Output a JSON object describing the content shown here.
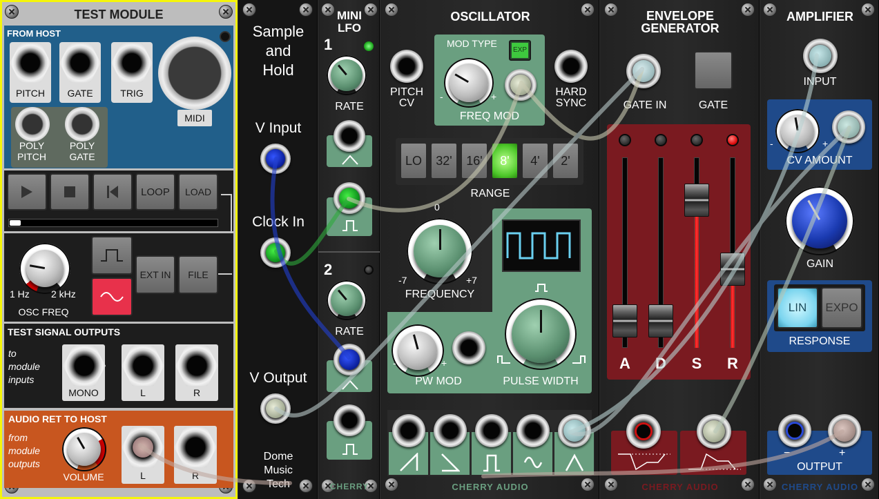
{
  "test_module": {
    "title": "TEST MODULE",
    "from_host": "FROM HOST",
    "pitch": "PITCH",
    "gate": "GATE",
    "trig": "TRIG",
    "midi": "MIDI",
    "poly_pitch": "POLY\nPITCH",
    "poly_gate": "POLY\nGATE",
    "loop": "LOOP",
    "load": "LOAD",
    "ext_in": "EXT IN",
    "file": "FILE",
    "freq_min": "1 Hz",
    "freq_max": "2 kHz",
    "osc_freq": "OSC FREQ",
    "test_outputs": "TEST SIGNAL OUTPUTS",
    "to_module_inputs": "to\nmodule\ninputs",
    "mono": "MONO",
    "l": "L",
    "r": "R",
    "audio_ret": "AUDIO RET TO HOST",
    "from_module_outputs": "from\nmodule\noutputs",
    "volume": "VOLUME"
  },
  "sample_hold": {
    "title": "Sample\nand\nHold",
    "v_input": "V Input",
    "clock_in": "Clock In",
    "v_output": "V Output",
    "maker": "Dome\nMusic\nTech"
  },
  "mini_lfo": {
    "title": "MINI\nLFO",
    "lfo1": "1",
    "lfo2": "2",
    "rate": "RATE",
    "brand": "CHERRY"
  },
  "oscillator": {
    "title": "OSCILLATOR",
    "mod_type": "MOD TYPE",
    "exp": "EXP",
    "pitch_cv": "PITCH\nCV",
    "hard_sync": "HARD\nSYNC",
    "freq_mod": "FREQ MOD",
    "range_buttons": [
      "LO",
      "32'",
      "16'",
      "8'",
      "4'",
      "2'"
    ],
    "range": "RANGE",
    "freq_zero": "0",
    "freq_min": "-7",
    "freq_max": "+7",
    "frequency": "FREQUENCY",
    "pw_mod": "PW MOD",
    "pulse_width": "PULSE WIDTH",
    "brand": "CHERRY AUDIO",
    "minus": "-",
    "plus": "+"
  },
  "envelope": {
    "title": "ENVELOPE\nGENERATOR",
    "gate_in": "GATE IN",
    "gate": "GATE",
    "sliders": [
      "A",
      "D",
      "S",
      "R"
    ],
    "brand": "CHERRY AUDIO"
  },
  "amplifier": {
    "title": "AMPLIFIER",
    "input": "INPUT",
    "cv_amount": "CV AMOUNT",
    "gain": "GAIN",
    "lin": "LIN",
    "expo": "EXPO",
    "response": "RESPONSE",
    "output": "OUTPUT",
    "minus": "−",
    "plus": "+",
    "brand": "CHERRY AUDIO"
  }
}
